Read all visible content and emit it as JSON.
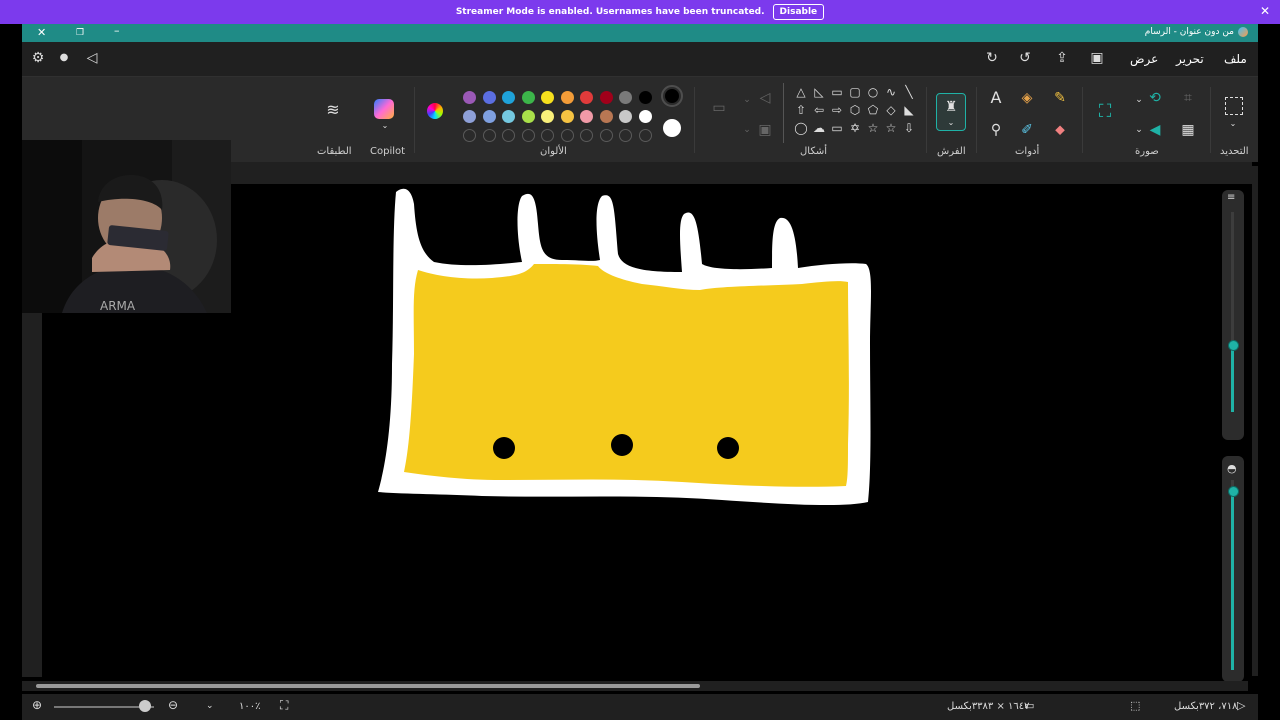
{
  "banner": {
    "text": "Streamer Mode is enabled. Usernames have been truncated.",
    "button": "Disable",
    "close": "✕"
  },
  "window": {
    "title": "من دون عنوان - الرسام",
    "menus": {
      "file": "ملف",
      "edit": "تحرير",
      "view": "عرض"
    },
    "groups": {
      "selection": "التحديد",
      "image": "صورة",
      "tools": "أدوات",
      "brushes": "الفرش",
      "shapes": "أشكال",
      "colors": "الألوان",
      "copilot": "Copilot",
      "layers": "الطبقات"
    },
    "colors": {
      "row1": [
        "#9b59b6",
        "#5b6ee1",
        "#1fa2d9",
        "#3cb54a",
        "#f7e01d",
        "#f39c38",
        "#e03b3b",
        "#a0001a",
        "#7a7a7a",
        "#000000"
      ],
      "row2": [
        "#8ea0d8",
        "#7fa0e0",
        "#74c8e0",
        "#a9e04a",
        "#f9f07a",
        "#f5c342",
        "#f19aa7",
        "#b97753",
        "#c8c8c8",
        "#ffffff"
      ],
      "primary": "#000000",
      "secondary": "#ffffff"
    },
    "status": {
      "zoom": "١٠٠٪",
      "canvas_size": "١٦٤٧ × ٣٣٨٣بكسل",
      "cursor_pos": "٧١٨، ٣٧٢بكسل"
    }
  },
  "drawing": {
    "outline_color": "#ffffff",
    "fill_color": "#f5cb1d",
    "dot_color": "#000000"
  },
  "icons": {
    "settings": "gear-icon",
    "notify": "bell-icon",
    "feedback": "megaphone-icon"
  }
}
